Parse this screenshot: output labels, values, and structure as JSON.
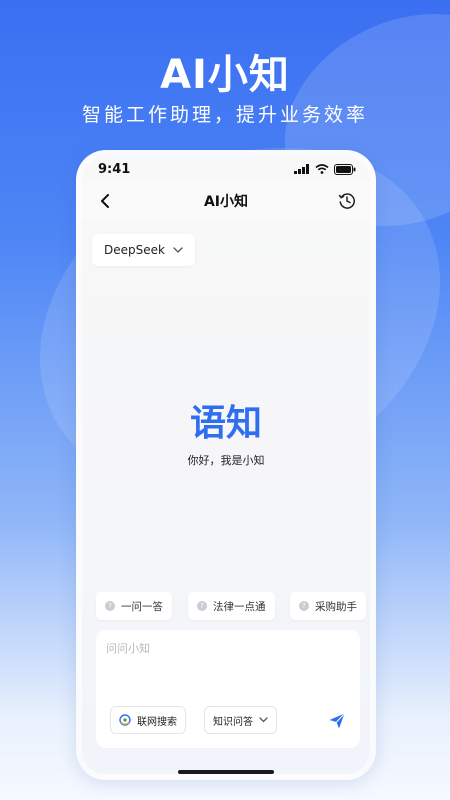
{
  "hero": {
    "title": "AI小知",
    "subtitle": "智能工作助理，提升业务效率"
  },
  "statusbar": {
    "time": "9:41"
  },
  "navbar": {
    "title": "AI小知",
    "back_icon": "chevron-left-icon",
    "history_icon": "history-clock-icon"
  },
  "model_select": {
    "value": "DeepSeek"
  },
  "logo": {
    "part1": "语",
    "part2": "知"
  },
  "greeting": "你好，我是小知",
  "quick_chips": [
    {
      "label": "一问一答"
    },
    {
      "label": "法律一点通"
    },
    {
      "label": "采购助手"
    }
  ],
  "input": {
    "placeholder": "问问小知"
  },
  "tools": {
    "web_search_label": "联网搜索",
    "mode_label": "知识问答"
  },
  "colors": {
    "brand": "#2f6ef0",
    "accent": "#f2b632",
    "background_top": "#3a6ff2"
  }
}
